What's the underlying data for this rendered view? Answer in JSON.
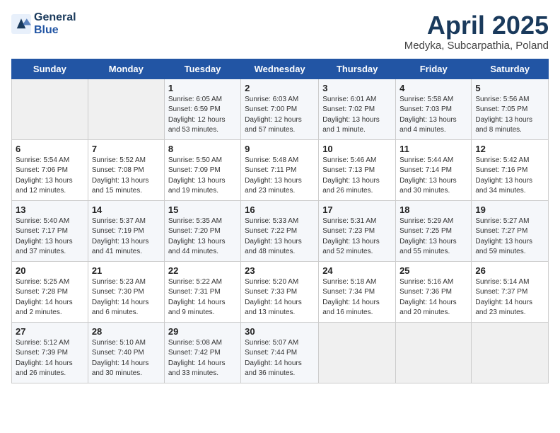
{
  "header": {
    "logo_line1": "General",
    "logo_line2": "Blue",
    "month": "April 2025",
    "location": "Medyka, Subcarpathia, Poland"
  },
  "days_of_week": [
    "Sunday",
    "Monday",
    "Tuesday",
    "Wednesday",
    "Thursday",
    "Friday",
    "Saturday"
  ],
  "weeks": [
    [
      {
        "day": "",
        "info": ""
      },
      {
        "day": "",
        "info": ""
      },
      {
        "day": "1",
        "info": "Sunrise: 6:05 AM\nSunset: 6:59 PM\nDaylight: 12 hours\nand 53 minutes."
      },
      {
        "day": "2",
        "info": "Sunrise: 6:03 AM\nSunset: 7:00 PM\nDaylight: 12 hours\nand 57 minutes."
      },
      {
        "day": "3",
        "info": "Sunrise: 6:01 AM\nSunset: 7:02 PM\nDaylight: 13 hours\nand 1 minute."
      },
      {
        "day": "4",
        "info": "Sunrise: 5:58 AM\nSunset: 7:03 PM\nDaylight: 13 hours\nand 4 minutes."
      },
      {
        "day": "5",
        "info": "Sunrise: 5:56 AM\nSunset: 7:05 PM\nDaylight: 13 hours\nand 8 minutes."
      }
    ],
    [
      {
        "day": "6",
        "info": "Sunrise: 5:54 AM\nSunset: 7:06 PM\nDaylight: 13 hours\nand 12 minutes."
      },
      {
        "day": "7",
        "info": "Sunrise: 5:52 AM\nSunset: 7:08 PM\nDaylight: 13 hours\nand 15 minutes."
      },
      {
        "day": "8",
        "info": "Sunrise: 5:50 AM\nSunset: 7:09 PM\nDaylight: 13 hours\nand 19 minutes."
      },
      {
        "day": "9",
        "info": "Sunrise: 5:48 AM\nSunset: 7:11 PM\nDaylight: 13 hours\nand 23 minutes."
      },
      {
        "day": "10",
        "info": "Sunrise: 5:46 AM\nSunset: 7:13 PM\nDaylight: 13 hours\nand 26 minutes."
      },
      {
        "day": "11",
        "info": "Sunrise: 5:44 AM\nSunset: 7:14 PM\nDaylight: 13 hours\nand 30 minutes."
      },
      {
        "day": "12",
        "info": "Sunrise: 5:42 AM\nSunset: 7:16 PM\nDaylight: 13 hours\nand 34 minutes."
      }
    ],
    [
      {
        "day": "13",
        "info": "Sunrise: 5:40 AM\nSunset: 7:17 PM\nDaylight: 13 hours\nand 37 minutes."
      },
      {
        "day": "14",
        "info": "Sunrise: 5:37 AM\nSunset: 7:19 PM\nDaylight: 13 hours\nand 41 minutes."
      },
      {
        "day": "15",
        "info": "Sunrise: 5:35 AM\nSunset: 7:20 PM\nDaylight: 13 hours\nand 44 minutes."
      },
      {
        "day": "16",
        "info": "Sunrise: 5:33 AM\nSunset: 7:22 PM\nDaylight: 13 hours\nand 48 minutes."
      },
      {
        "day": "17",
        "info": "Sunrise: 5:31 AM\nSunset: 7:23 PM\nDaylight: 13 hours\nand 52 minutes."
      },
      {
        "day": "18",
        "info": "Sunrise: 5:29 AM\nSunset: 7:25 PM\nDaylight: 13 hours\nand 55 minutes."
      },
      {
        "day": "19",
        "info": "Sunrise: 5:27 AM\nSunset: 7:27 PM\nDaylight: 13 hours\nand 59 minutes."
      }
    ],
    [
      {
        "day": "20",
        "info": "Sunrise: 5:25 AM\nSunset: 7:28 PM\nDaylight: 14 hours\nand 2 minutes."
      },
      {
        "day": "21",
        "info": "Sunrise: 5:23 AM\nSunset: 7:30 PM\nDaylight: 14 hours\nand 6 minutes."
      },
      {
        "day": "22",
        "info": "Sunrise: 5:22 AM\nSunset: 7:31 PM\nDaylight: 14 hours\nand 9 minutes."
      },
      {
        "day": "23",
        "info": "Sunrise: 5:20 AM\nSunset: 7:33 PM\nDaylight: 14 hours\nand 13 minutes."
      },
      {
        "day": "24",
        "info": "Sunrise: 5:18 AM\nSunset: 7:34 PM\nDaylight: 14 hours\nand 16 minutes."
      },
      {
        "day": "25",
        "info": "Sunrise: 5:16 AM\nSunset: 7:36 PM\nDaylight: 14 hours\nand 20 minutes."
      },
      {
        "day": "26",
        "info": "Sunrise: 5:14 AM\nSunset: 7:37 PM\nDaylight: 14 hours\nand 23 minutes."
      }
    ],
    [
      {
        "day": "27",
        "info": "Sunrise: 5:12 AM\nSunset: 7:39 PM\nDaylight: 14 hours\nand 26 minutes."
      },
      {
        "day": "28",
        "info": "Sunrise: 5:10 AM\nSunset: 7:40 PM\nDaylight: 14 hours\nand 30 minutes."
      },
      {
        "day": "29",
        "info": "Sunrise: 5:08 AM\nSunset: 7:42 PM\nDaylight: 14 hours\nand 33 minutes."
      },
      {
        "day": "30",
        "info": "Sunrise: 5:07 AM\nSunset: 7:44 PM\nDaylight: 14 hours\nand 36 minutes."
      },
      {
        "day": "",
        "info": ""
      },
      {
        "day": "",
        "info": ""
      },
      {
        "day": "",
        "info": ""
      }
    ]
  ]
}
